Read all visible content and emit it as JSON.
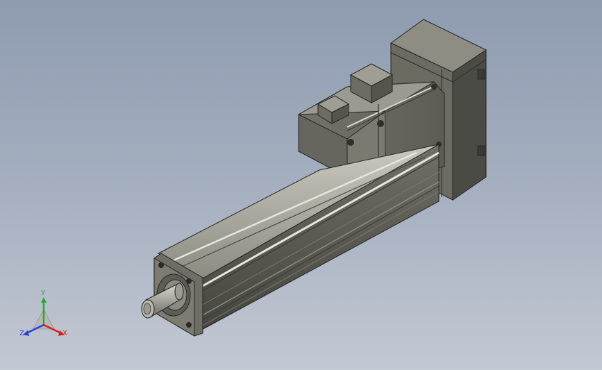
{
  "viewport": {
    "triad": {
      "x_label": "X",
      "y_label": "Y",
      "z_label": "Z",
      "x_color": "#d42020",
      "y_color": "#2fa52f",
      "z_color": "#2d3ed6"
    }
  }
}
